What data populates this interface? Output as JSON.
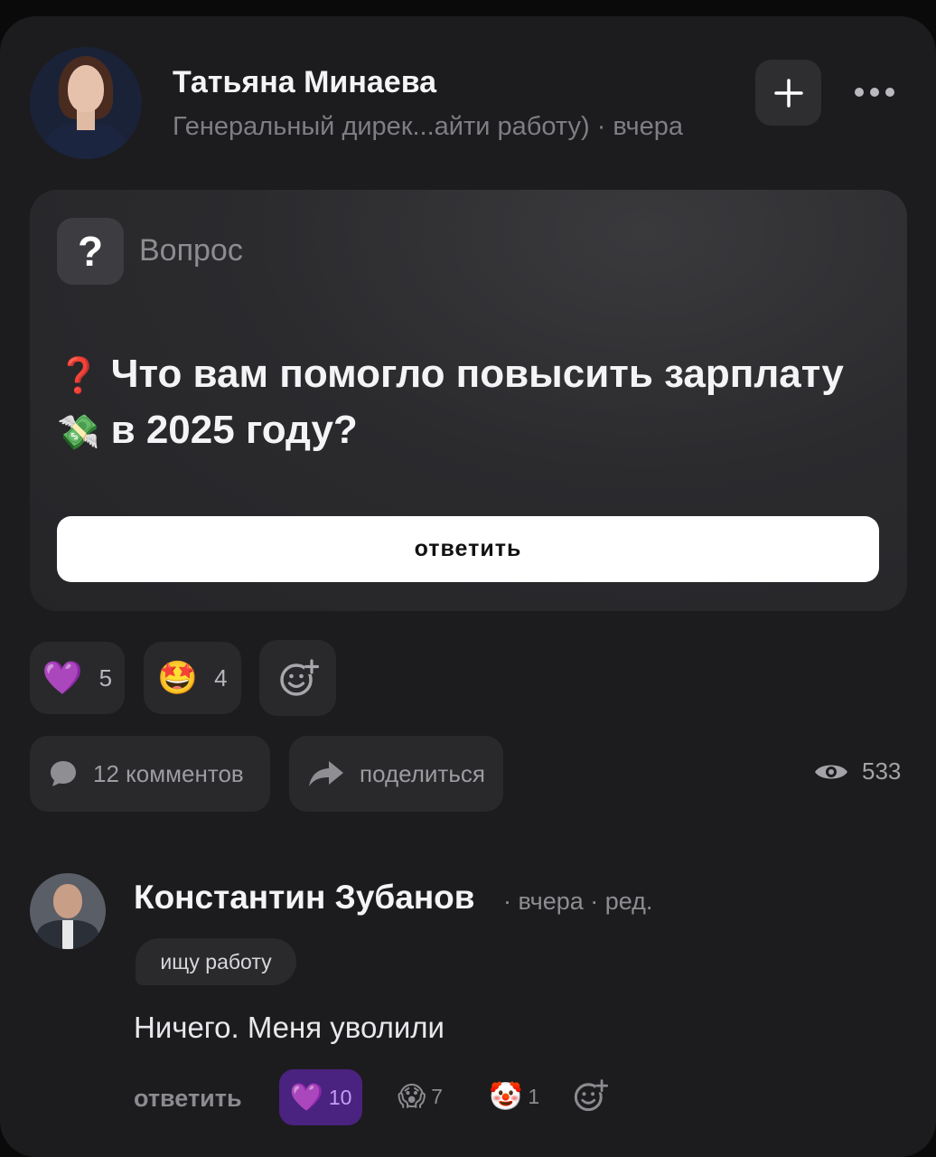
{
  "post": {
    "author": "Татьяна Минаева",
    "meta": "Генеральный дирек...айти работу) · вчера",
    "type_label": "Вопрос",
    "question": "Что вам помогло повысить зарплату",
    "question_line2": "в 2025 году?",
    "question_mark_emoji": "❓",
    "money_emoji": "💸",
    "answer_button": "ответить",
    "reactions": [
      {
        "emoji": "💜",
        "count": "5"
      },
      {
        "emoji": "🤩",
        "count": "4"
      }
    ],
    "comments_label": "12 комментов",
    "share_label": "поделиться",
    "views": "533"
  },
  "comment": {
    "author": "Константин Зубанов",
    "meta": "· вчера · ред.",
    "badge": "ищу работу",
    "text": "Ничего. Меня уволили",
    "reply_label": "ответить",
    "reactions": [
      {
        "emoji": "💜",
        "count": "10"
      },
      {
        "emoji": "😱",
        "count": "7"
      },
      {
        "emoji": "🤡",
        "count": "1"
      }
    ]
  },
  "colors": {
    "background": "#1c1c1e",
    "accent_purple": "#4a2280",
    "button_white": "#ffffff"
  }
}
